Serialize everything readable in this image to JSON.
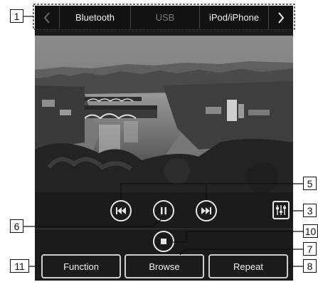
{
  "source_tabs": {
    "prev_icon": "chevron-left-icon",
    "next_icon": "chevron-right-icon",
    "items": [
      {
        "label": "Bluetooth",
        "active": false
      },
      {
        "label": "USB",
        "active": true
      },
      {
        "label": "iPod/iPhone",
        "active": false
      }
    ]
  },
  "album_art": {
    "type": "photo"
  },
  "controls": {
    "previous_icon": "skip-previous-icon",
    "pause_icon": "pause-icon",
    "next_icon": "skip-next-icon",
    "stop_icon": "stop-icon",
    "sound_settings_icon": "equalizer-icon"
  },
  "bottom_buttons": {
    "function": "Function",
    "browse": "Browse",
    "repeat": "Repeat"
  },
  "callouts": {
    "c1": "1",
    "c3": "3",
    "c5": "5",
    "c6": "6",
    "c7": "7",
    "c8": "8",
    "c10": "10",
    "c11": "11"
  },
  "colors": {
    "screen_bg": "#1b1b1b",
    "tab_text": "#f2f2f2",
    "tab_dim": "#7d7d7d",
    "control": "#e6e6e6"
  }
}
